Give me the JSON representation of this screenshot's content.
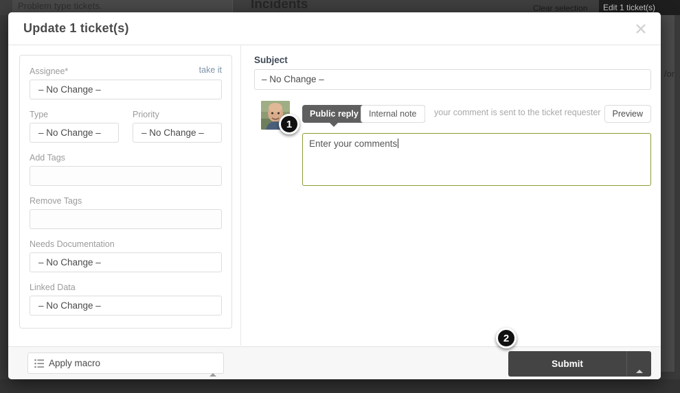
{
  "background": {
    "problem_text": "Problem type tickets.",
    "incidents_title": "Incidents",
    "clear_selection": "Clear selection",
    "edit_tickets": "Edit 1 ticket(s)",
    "right_clipped_text": "/or"
  },
  "modal": {
    "title": "Update 1 ticket(s)",
    "close_icon": "close-icon"
  },
  "left_form": {
    "assignee": {
      "label": "Assignee*",
      "take_it": "take it",
      "value": "– No Change –"
    },
    "type": {
      "label": "Type",
      "value": "– No Change –"
    },
    "priority": {
      "label": "Priority",
      "value": "– No Change –"
    },
    "add_tags": {
      "label": "Add Tags",
      "value": "",
      "placeholder": ""
    },
    "remove_tags": {
      "label": "Remove Tags",
      "value": "",
      "placeholder": ""
    },
    "needs_documentation": {
      "label": "Needs Documentation",
      "value": "– No Change –"
    },
    "linked_data": {
      "label": "Linked Data",
      "value": "– No Change –"
    }
  },
  "right_panel": {
    "subject_label": "Subject",
    "subject_value": "– No Change –",
    "avatar_name": "avatar",
    "tab_public_reply": "Public reply",
    "tab_internal_note": "Internal note",
    "reply_hint": "your comment is sent to the ticket requester",
    "preview_button": "Preview",
    "comment_placeholder": "Enter your comments"
  },
  "footer": {
    "apply_macro_label": "Apply macro",
    "apply_macro_icon": "list-icon",
    "submit_label": "Submit",
    "submit_caret_icon": "chevron-up-icon"
  },
  "callouts": {
    "one": "1",
    "two": "2"
  },
  "colors": {
    "accent_green": "#8a9a33",
    "submit_dark": "#444444",
    "tab_active": "#5f5f5f",
    "link_blue": "#7d93a8"
  }
}
